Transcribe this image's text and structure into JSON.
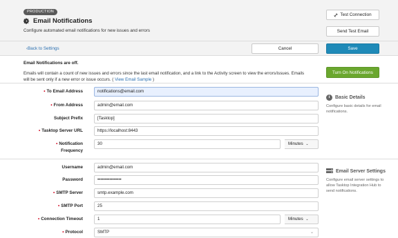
{
  "header": {
    "env_badge": "PRODUCTION",
    "title": "Email Notifications",
    "subtitle": "Configure automated email notifications for new issues and errors",
    "test_connection_label": "Test Connection",
    "send_test_email_label": "Send Test Email"
  },
  "actionbar": {
    "back_label": "Back to Settings",
    "cancel_label": "Cancel",
    "save_label": "Save"
  },
  "notice": {
    "title": "Email Notifications are off.",
    "body": "Emails will contain a count of new issues and errors since the last email notification, and a link to the Activity screen to view the errors/issues. Emails will be sent only if a new error or issue occurs. (",
    "link": "View Email Sample",
    "body_end": " )",
    "turn_on_label": "Turn On Notifications"
  },
  "basic": {
    "side_title": "Basic Details",
    "side_text": "Configure basic details for email notifications.",
    "fields": {
      "to_label": "To Email Address",
      "to_value": "notifications@email.com",
      "from_label": "From Address",
      "from_value": "admin@email.com",
      "prefix_label": "Subject Prefix",
      "prefix_value": "[Tasktop]",
      "url_label": "Tasktop Server URL",
      "url_value": "https://localhost:8443",
      "freq_label_1": "Notification",
      "freq_label_2": "Frequency",
      "freq_value": "30",
      "freq_unit": "Minutes"
    }
  },
  "server": {
    "side_title": "Email Server Settings",
    "side_text": "Configure email server settings to allow Tasktop Integration Hub to send notifications.",
    "fields": {
      "username_label": "Username",
      "username_value": "admin@email.com",
      "password_label": "Password",
      "password_value": "••••••••••••••••",
      "smtp_server_label": "SMTP Server",
      "smtp_server_value": "smtp.example.com",
      "smtp_port_label": "SMTP Port",
      "smtp_port_value": "25",
      "timeout_label": "Connection Timeout",
      "timeout_value": "1",
      "timeout_unit": "Minutes",
      "protocol_label": "Protocol",
      "protocol_value": "SMTP"
    }
  },
  "required_marker": "•",
  "caret": "⌄"
}
